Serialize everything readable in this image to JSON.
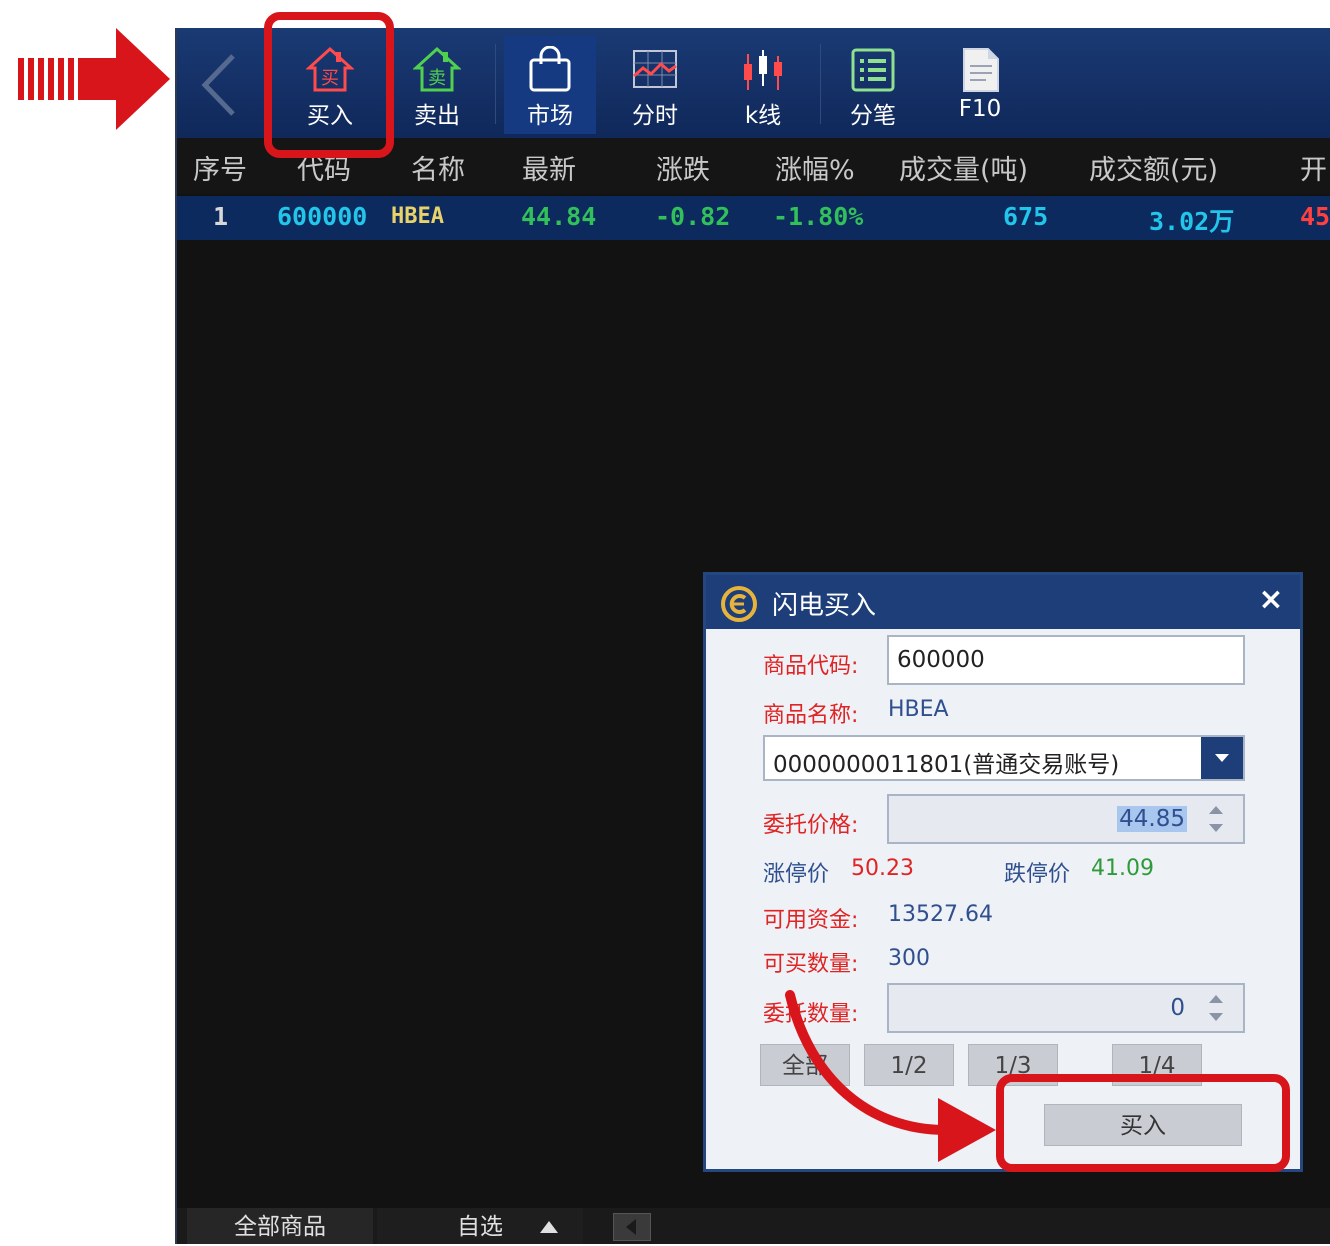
{
  "toolbar": {
    "buttons": [
      {
        "label": "买入",
        "icon": "buy-house-icon",
        "glyph": "买"
      },
      {
        "label": "卖出",
        "icon": "sell-house-icon",
        "glyph": "卖"
      },
      {
        "label": "市场",
        "icon": "market-bag-icon"
      },
      {
        "label": "分时",
        "icon": "timeshare-chart-icon"
      },
      {
        "label": "k线",
        "icon": "candlestick-icon"
      },
      {
        "label": "分笔",
        "icon": "tick-list-icon"
      },
      {
        "label": "F10",
        "icon": "document-icon"
      }
    ]
  },
  "table": {
    "columns": [
      "序号",
      "代码",
      "名称",
      "最新",
      "涨跌",
      "涨幅%",
      "成交量(吨)",
      "成交额(元)",
      "开"
    ],
    "rows": [
      {
        "index": "1",
        "code": "600000",
        "name": "HBEA",
        "latest": "44.84",
        "change": "-0.82",
        "pct": "-1.80%",
        "volume": "675",
        "amount": "3.02万",
        "open": "45"
      }
    ]
  },
  "bottom_tabs": [
    "全部商品",
    "自选"
  ],
  "dialog": {
    "title": "闪电买入",
    "code_label": "商品代码:",
    "code_value": "600000",
    "name_label": "商品名称:",
    "name_value": "HBEA",
    "account": "0000000011801(普通交易账号)",
    "price_label": "委托价格:",
    "price_value": "44.85",
    "limit_up_label": "涨停价",
    "limit_up_value": "50.23",
    "limit_down_label": "跌停价",
    "limit_down_value": "41.09",
    "funds_label": "可用资金:",
    "funds_value": "13527.64",
    "buyable_label": "可买数量:",
    "buyable_value": "300",
    "qty_label": "委托数量:",
    "qty_value": "0",
    "fractions": [
      "全部",
      "1/2",
      "1/3",
      "1/4"
    ],
    "submit_label": "买入",
    "close": "×"
  },
  "colors": {
    "toolbar_bg": "#10285a",
    "row_highlight": "#0d2a5e",
    "code_cyan": "#22c6ea",
    "name_yellow": "#e8d26a",
    "green": "#31c05a",
    "annotation_red": "#d8151b"
  }
}
